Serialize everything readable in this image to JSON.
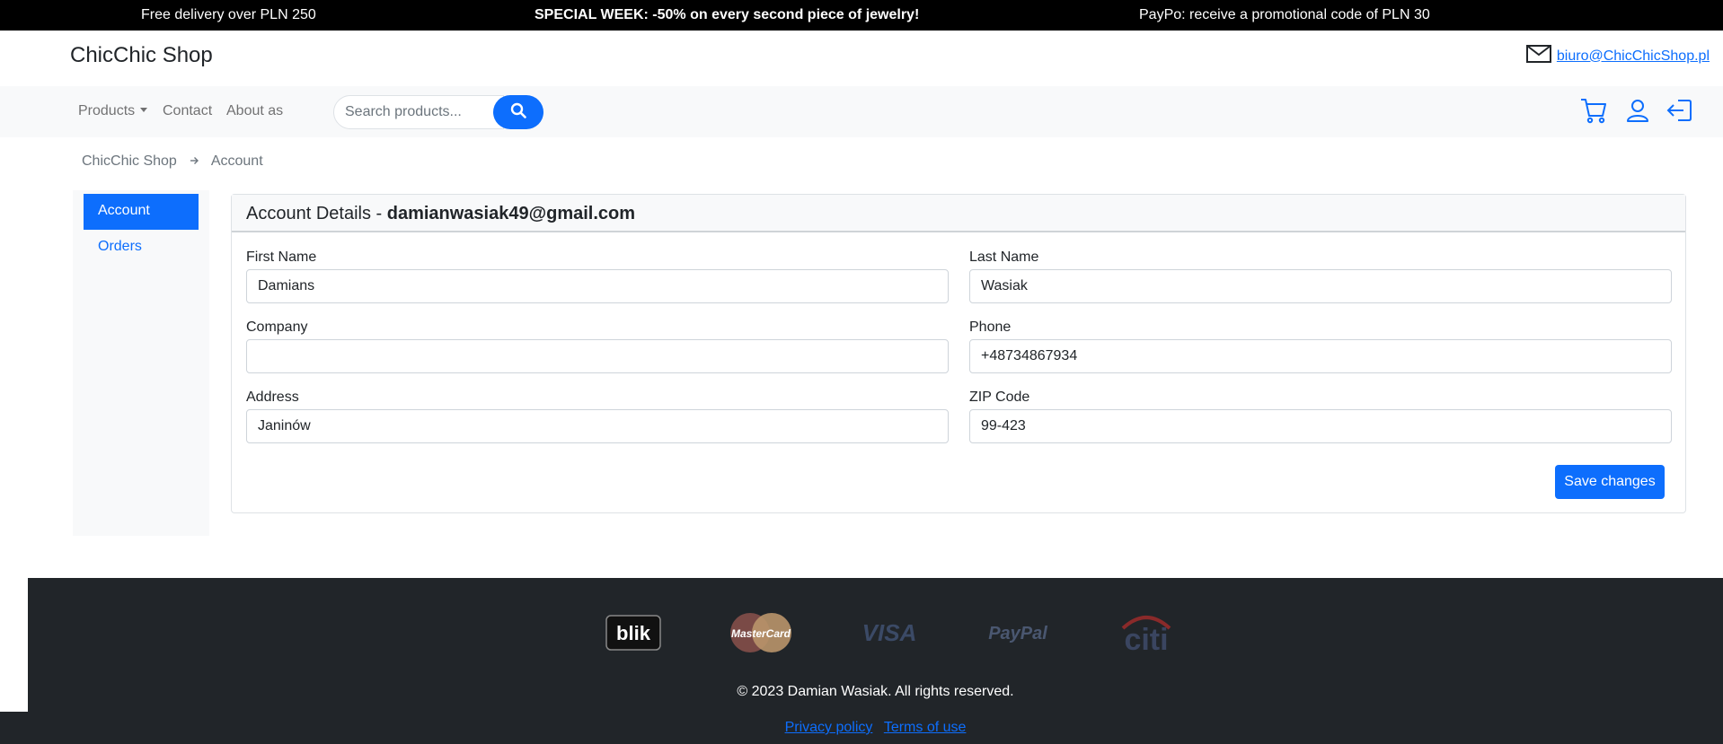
{
  "announcements": [
    "Free delivery over PLN 250",
    "SPECIAL WEEK: -50% on every second piece of jewelry!",
    "PayPo: receive a promotional code of PLN 30"
  ],
  "header": {
    "brand": "ChicChic Shop",
    "email": "biuro@ChicChicShop.pl"
  },
  "nav": {
    "products": "Products",
    "contact": "Contact",
    "about": "About as",
    "search_placeholder": "Search products..."
  },
  "breadcrumb": {
    "home": "ChicChic Shop",
    "current": "Account"
  },
  "sidebar": {
    "items": [
      {
        "label": "Account"
      },
      {
        "label": "Orders"
      }
    ]
  },
  "account": {
    "title_prefix": "Account Details - ",
    "email": "damianwasiak49@gmail.com",
    "fields": {
      "first_name": {
        "label": "First Name",
        "value": "Damians"
      },
      "last_name": {
        "label": "Last Name",
        "value": "Wasiak"
      },
      "company": {
        "label": "Company",
        "value": ""
      },
      "phone": {
        "label": "Phone",
        "value": "+48734867934"
      },
      "address": {
        "label": "Address",
        "value": "Janinów"
      },
      "zip": {
        "label": "ZIP Code",
        "value": "99-423"
      }
    },
    "save_label": "Save changes"
  },
  "footer": {
    "payments": [
      {
        "name": "blik",
        "text": "blik"
      },
      {
        "name": "mastercard",
        "text": "MasterCard"
      },
      {
        "name": "visa",
        "text": "VISA"
      },
      {
        "name": "paypal",
        "text": "PayPal"
      },
      {
        "name": "citi",
        "text": "citi"
      }
    ],
    "copyright": "© 2023 Damian Wasiak. All rights reserved.",
    "privacy": "Privacy policy",
    "terms": "Terms of use"
  },
  "colors": {
    "primary": "#0d6efd",
    "dark": "#212529",
    "light_bg": "#f8f9fa"
  }
}
